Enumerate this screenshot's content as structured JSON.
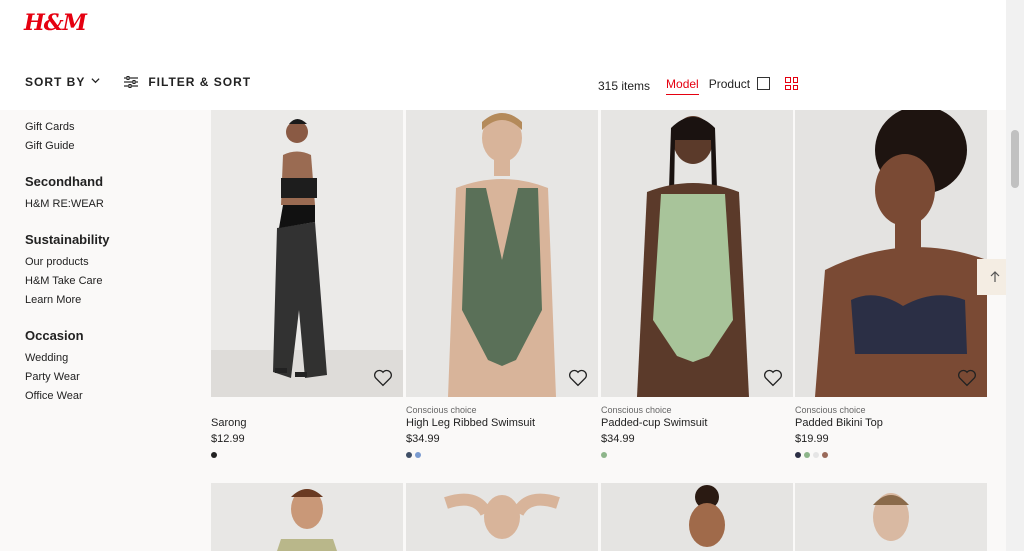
{
  "brand": {
    "logo": "H&M"
  },
  "toolbar": {
    "sort_label": "SORT BY",
    "filter_label": "FILTER & SORT",
    "count": "315 items",
    "view_model": "Model",
    "view_product": "Product"
  },
  "sidebar": {
    "top_links": [
      "Gift Cards",
      "Gift Guide"
    ],
    "sections": [
      {
        "heading": "Secondhand",
        "links": [
          "H&M RE:WEAR"
        ]
      },
      {
        "heading": "Sustainability",
        "links": [
          "Our products",
          "H&M Take Care",
          "Learn More"
        ]
      },
      {
        "heading": "Occasion",
        "links": [
          "Wedding",
          "Party Wear",
          "Office Wear"
        ]
      }
    ]
  },
  "products": [
    {
      "tag": "",
      "name": "Sarong",
      "price": "$12.99",
      "swatches": [
        "#222222"
      ]
    },
    {
      "tag": "Conscious choice",
      "name": "High Leg Ribbed Swimsuit",
      "price": "$34.99",
      "swatches": [
        "#3f4f66",
        "#7a9bd0"
      ]
    },
    {
      "tag": "Conscious choice",
      "name": "Padded-cup Swimsuit",
      "price": "$34.99",
      "swatches": [
        "#8db58a"
      ]
    },
    {
      "tag": "Conscious choice",
      "name": "Padded Bikini Top",
      "price": "$19.99",
      "swatches": [
        "#2b2f45",
        "#8db58a",
        "#e5e5e5",
        "#9a6a5a"
      ]
    }
  ],
  "colors": {
    "accent": "#e50010",
    "background": "#faf9f8"
  }
}
